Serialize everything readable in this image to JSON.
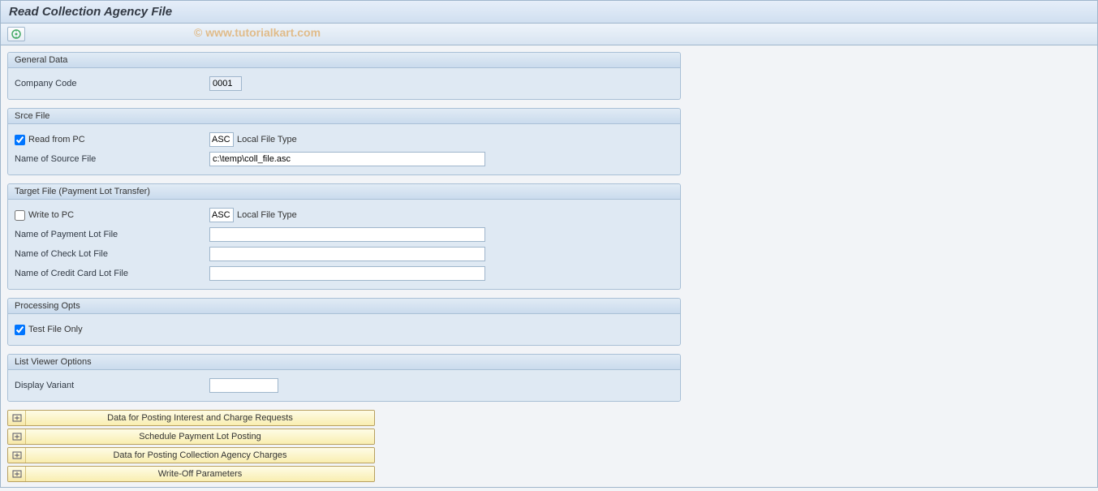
{
  "page_title": "Read Collection Agency File",
  "watermark": "© www.tutorialkart.com",
  "groups": {
    "general": {
      "title": "General Data",
      "company_code_label": "Company Code",
      "company_code_value": "0001"
    },
    "srce": {
      "title": "Srce File",
      "read_pc_label": "Read from PC",
      "read_pc_checked": true,
      "file_type_code": "ASC",
      "file_type_label": "Local File Type",
      "source_name_label": "Name of Source File",
      "source_name_value": "c:\\temp\\coll_file.asc"
    },
    "target": {
      "title": "Target File (Payment Lot Transfer)",
      "write_pc_label": "Write to PC",
      "write_pc_checked": false,
      "file_type_code": "ASC",
      "file_type_label": "Local File Type",
      "payment_lot_label": "Name of Payment Lot File",
      "payment_lot_value": "",
      "check_lot_label": "Name of Check Lot File",
      "check_lot_value": "",
      "credit_lot_label": "Name of Credit Card Lot File",
      "credit_lot_value": ""
    },
    "proc": {
      "title": "Processing Opts",
      "test_label": "Test File Only",
      "test_checked": true
    },
    "list": {
      "title": "List Viewer Options",
      "variant_label": "Display Variant",
      "variant_value": ""
    }
  },
  "expand_panels": [
    "Data for Posting Interest and Charge Requests",
    "Schedule Payment Lot Posting",
    "Data for Posting Collection Agency Charges",
    "Write-Off Parameters"
  ]
}
